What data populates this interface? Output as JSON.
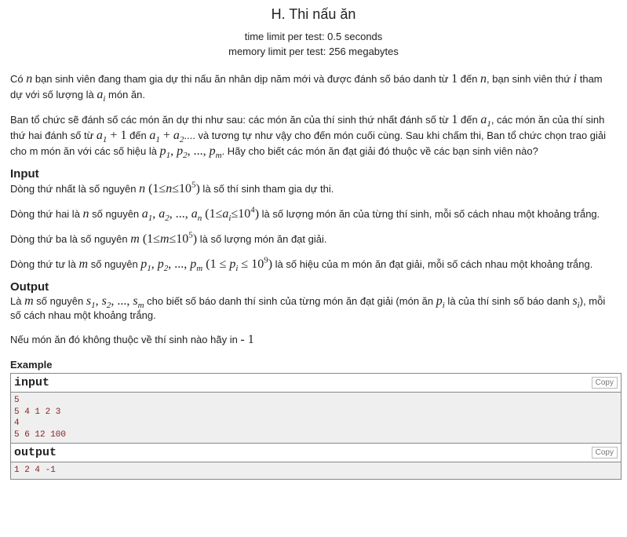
{
  "title": "H. Thi nấu ăn",
  "time_limit": "time limit per test: 0.5 seconds",
  "memory_limit": "memory limit per test: 256 megabytes",
  "statement": {
    "p1": {
      "a": "Có ",
      "b": " bạn sinh viên đang tham gia dự thi nấu ăn nhân dịp năm mới và được đánh số báo danh từ ",
      "c": " đến ",
      "d": ", bạn sinh viên thứ ",
      "e": " tham dự với số lượng là ",
      "f": " món ăn."
    },
    "p2": {
      "a": "Ban tổ chức sẽ đánh số các món ăn dự thi như sau: các món ăn của thí sinh thứ nhất đánh số từ ",
      "b": " đến ",
      "c": ", các món ăn của thí sinh thứ hai đánh số từ ",
      "d": " đến ",
      "e": ".... và tương tự như vậy cho đến món cuối cùng. Sau khi chấm thi, Ban tổ chức chọn trao giải cho m món ăn với các số hiệu là ",
      "f": ". Hãy cho biết các món ăn đạt giải đó thuộc về các bạn sinh viên nào?"
    }
  },
  "input_section": {
    "heading": "Input",
    "l1": {
      "a": "Dòng thứ nhất là số nguyên ",
      "b": " là số thí sinh tham gia dự thi."
    },
    "l2": {
      "a": "Dòng thứ hai là ",
      "b": " số nguyên ",
      "c": " là số lượng món ăn của từng thí sinh, mỗi số cách nhau một khoảng trắng."
    },
    "l3": {
      "a": "Dòng thứ ba là số nguyên ",
      "b": " là số lượng món ăn đạt giải."
    },
    "l4": {
      "a": "Dòng thứ tư là ",
      "b": " số nguyên ",
      "c": " là số hiệu của m món ăn đạt giải, mỗi số cách nhau một khoảng trắng."
    }
  },
  "output_section": {
    "heading": "Output",
    "l1": {
      "a": "Là ",
      "b": " số nguyên ",
      "c": " cho biết số báo danh thí sinh của từng món ăn đạt giải (món ăn ",
      "d": " là của thí sinh số báo danh ",
      "e": "), mỗi số cách nhau một khoảng trắng."
    },
    "l2": {
      "a": "Nếu món ăn đó không thuộc về thí sinh nào hãy in ",
      "b": "- 1"
    }
  },
  "example": {
    "heading": "Example",
    "input_title": "input",
    "output_title": "output",
    "copy_label": "Copy",
    "input_text": "5\n5 4 1 2 3\n4\n5 6 12 100",
    "output_text": "1 2 4 -1"
  }
}
